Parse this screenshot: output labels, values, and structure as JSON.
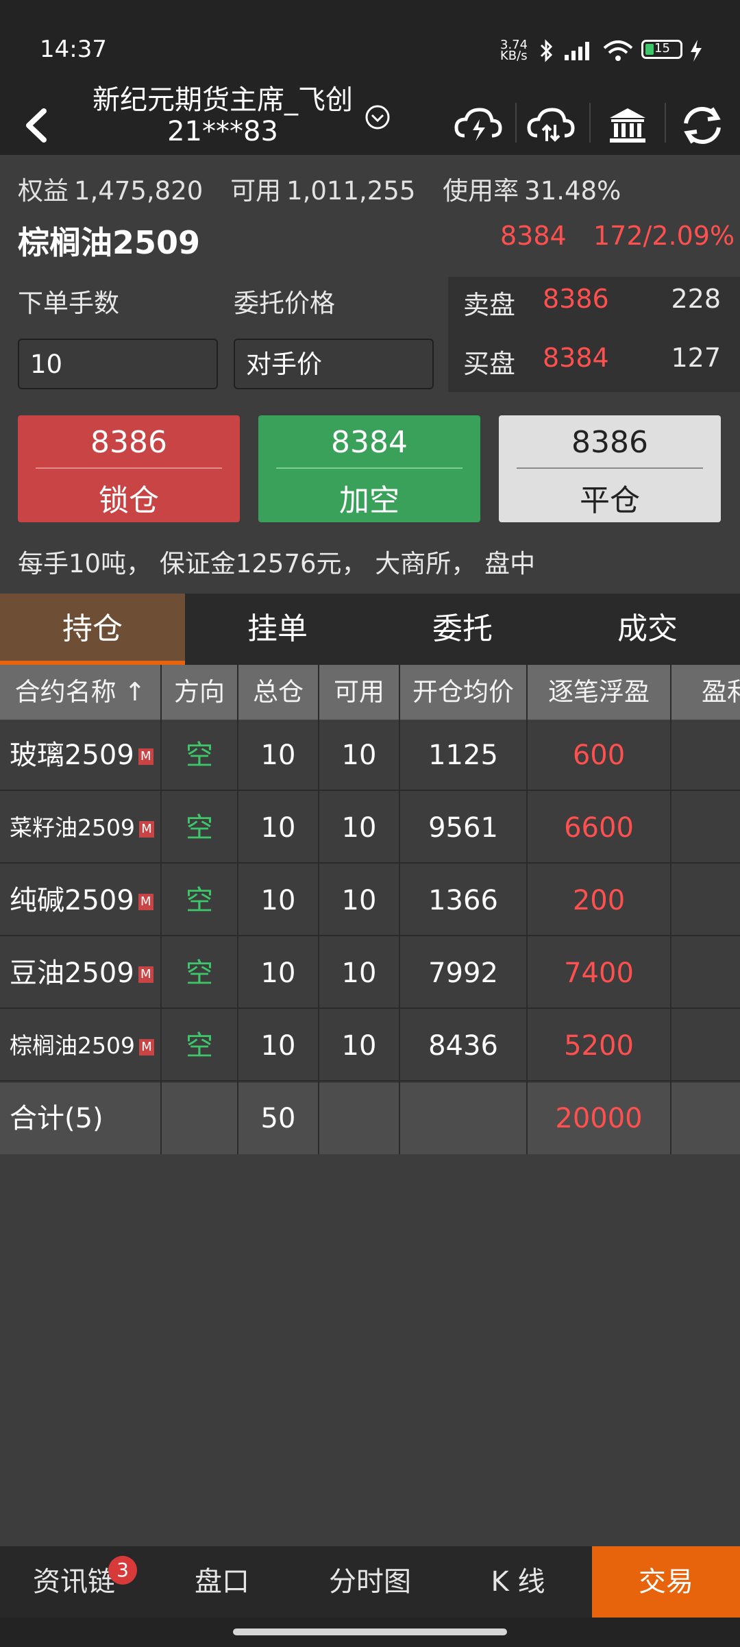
{
  "status_bar": {
    "time": "14:37",
    "net_speed": "3.74 KB/s",
    "battery": "15"
  },
  "header": {
    "account_name": "新纪元期货主席_飞创",
    "account_id": "21***83",
    "icons": [
      "back-icon",
      "chevron-down-icon",
      "cloud-lightning-icon",
      "cloud-sync-icon",
      "bank-icon",
      "refresh-icon"
    ]
  },
  "summary": {
    "equity_label": "权益",
    "equity_value": "1,475,820",
    "available_label": "可用",
    "available_value": "1,011,255",
    "usage_label": "使用率",
    "usage_value": "31.48%"
  },
  "contract": {
    "name": "棕榈油2509",
    "last_price": "8384",
    "change": "172/2.09%"
  },
  "order_form": {
    "qty_label": "下单手数",
    "qty_value": "10",
    "price_label": "委托价格",
    "price_value": "对手价"
  },
  "order_book": {
    "ask_label": "卖盘",
    "ask_price": "8386",
    "ask_volume": "228",
    "bid_label": "买盘",
    "bid_price": "8384",
    "bid_volume": "127"
  },
  "buttons": {
    "lock_price": "8386",
    "lock_label": "锁仓",
    "short_price": "8384",
    "short_label": "加空",
    "close_price": "8386",
    "close_label": "平仓"
  },
  "contract_info": "每手10吨， 保证金12576元， 大商所， 盘中",
  "tabs": [
    "持仓",
    "挂单",
    "委托",
    "成交"
  ],
  "table": {
    "headers": [
      "合约名称 ↑",
      "方向",
      "总仓",
      "可用",
      "开仓均价",
      "逐笔浮盈",
      "盈利"
    ],
    "rows": [
      {
        "name": "玻璃2509",
        "badge": "M",
        "dir": "空",
        "total": "10",
        "avail": "10",
        "avg": "1125",
        "pnl": "600"
      },
      {
        "name": "菜籽油2509",
        "badge": "M",
        "dir": "空",
        "total": "10",
        "avail": "10",
        "avg": "9561",
        "pnl": "6600"
      },
      {
        "name": "纯碱2509",
        "badge": "M",
        "dir": "空",
        "total": "10",
        "avail": "10",
        "avg": "1366",
        "pnl": "200"
      },
      {
        "name": "豆油2509",
        "badge": "M",
        "dir": "空",
        "total": "10",
        "avail": "10",
        "avg": "7992",
        "pnl": "7400"
      },
      {
        "name": "棕榈油2509",
        "badge": "M",
        "dir": "空",
        "total": "10",
        "avail": "10",
        "avg": "8436",
        "pnl": "5200"
      }
    ],
    "total": {
      "label": "合计(5)",
      "total": "50",
      "pnl": "20000"
    }
  },
  "bottom_nav": {
    "items": [
      "资讯链",
      "盘口",
      "分时图",
      "K 线",
      "交易"
    ],
    "news_badge": "3"
  },
  "colors": {
    "accent": "#e8640c",
    "up_red": "#ff5050",
    "short_green": "#3ec76a",
    "lock_button": "#c94545",
    "short_button": "#39a15a"
  }
}
